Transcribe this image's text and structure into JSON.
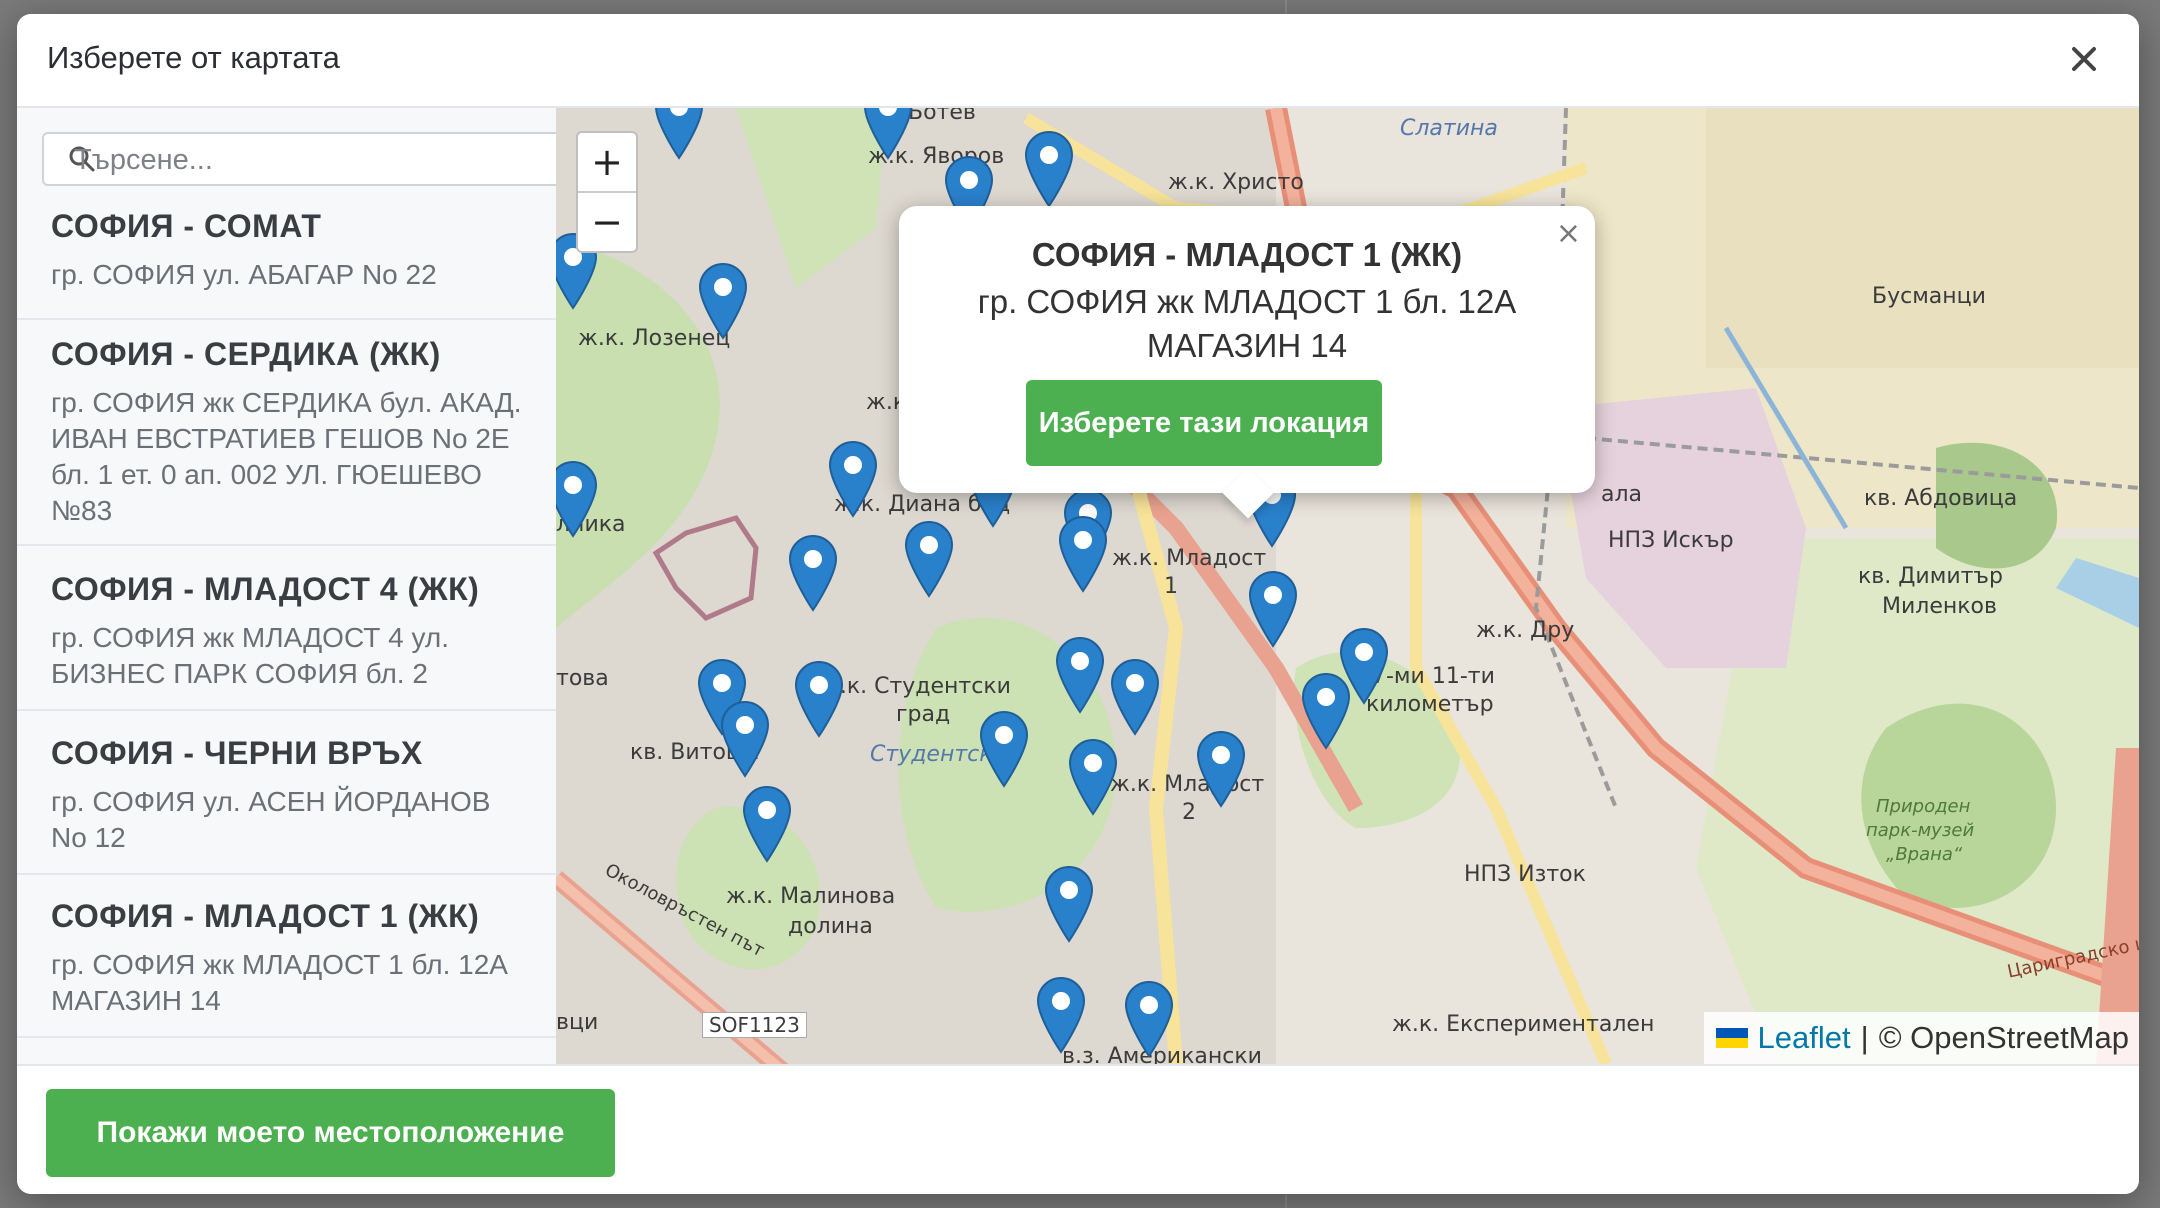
{
  "modal": {
    "title": "Изберете от картата"
  },
  "search": {
    "placeholder": "Търсене..."
  },
  "locations": [
    {
      "name": "СОФИЯ - СОМАТ",
      "address": "гр. СОФИЯ ул. АБАГАР No 22"
    },
    {
      "name": "СОФИЯ - СЕРДИКА (ЖК)",
      "address": "гр. СОФИЯ жк СЕРДИКА бул. АКАД. ИВАН ЕВСТРАТИЕВ ГЕШОВ No 2Е бл. 1 ет. 0 ап. 002 УЛ. ГЮЕШЕВО №83"
    },
    {
      "name": "СОФИЯ - МЛАДОСТ 4 (ЖК)",
      "address": "гр. СОФИЯ жк МЛАДОСТ 4 ул. БИЗНЕС ПАРК СОФИЯ бл. 2"
    },
    {
      "name": "СОФИЯ - ЧЕРНИ ВРЪХ",
      "address": "гр. СОФИЯ ул. АСЕН ЙОРДАНОВ No 12"
    },
    {
      "name": "СОФИЯ - МЛАДОСТ 1 (ЖК)",
      "address": "гр. СОФИЯ жк МЛАДОСТ 1 бл. 12А МАГАЗИН 14"
    }
  ],
  "popup": {
    "name": "СОФИЯ - МЛАДОСТ 1 (ЖК)",
    "address": "гр. СОФИЯ жк МЛАДОСТ 1 бл. 12А МАГАЗИН 14",
    "select_label": "Изберете тази локация",
    "close_symbol": "×"
  },
  "map": {
    "zoom_in": "+",
    "zoom_out": "−",
    "labels": {
      "botev": "Ботев",
      "slatina": "Слатина",
      "yavorov": "ж.к. Яворов",
      "hristo": "ж.к. Христо",
      "lozenets": "ж.к. Лозенец",
      "busmantsi": "Бусманци",
      "zhk": "ж.к.",
      "diana": "ж.к. Диана бад",
      "mladost": "ж.к. Младост",
      "one": "1",
      "abdovitsa": "кв. Абдовица",
      "npz_iskar": "НПЗ Искър",
      "dimitar": "кв. Димитър",
      "milenkov": "Миленков",
      "druzhba": "ж.к. Дру",
      "kilometar_a": "7-ми 11-ти",
      "kilometar_b": "километър",
      "studentski_a": "ж.к. Студентски",
      "studentski_b": "град",
      "studentski_it": "Студентски",
      "vitosha": "кв. Витоша",
      "mladost2": "ж.к. Младост",
      "two": "2",
      "npz_iztok": "НПЗ Изток",
      "malinova_a": "ж.к. Малинова",
      "malinova_b": "долина",
      "okolovrasten": "Околовръстен път",
      "sof": "SOF1123",
      "vtsi": "вци",
      "amerikanski": "в.з. Американски",
      "eksperimentalen": "ж.к. Експериментален",
      "tsarigradsko": "Цариградско ш.",
      "vrana_a": "Природен",
      "vrana_b": "парк-музей",
      "vrana_c": "„Врана“",
      "nika": "лника",
      "tova": "това",
      "ala": "ала"
    },
    "attribution_link": "Leaflet",
    "attribution_sep": "|",
    "attribution_text": "© OpenStreetMap"
  },
  "footer": {
    "locate_label": "Покажи моето местоположение"
  },
  "colors": {
    "accent_green": "#4caf50",
    "marker_blue": "#2a81cb"
  },
  "icons": {
    "close": "close-icon",
    "search": "search-icon",
    "marker": "map-marker-icon"
  }
}
